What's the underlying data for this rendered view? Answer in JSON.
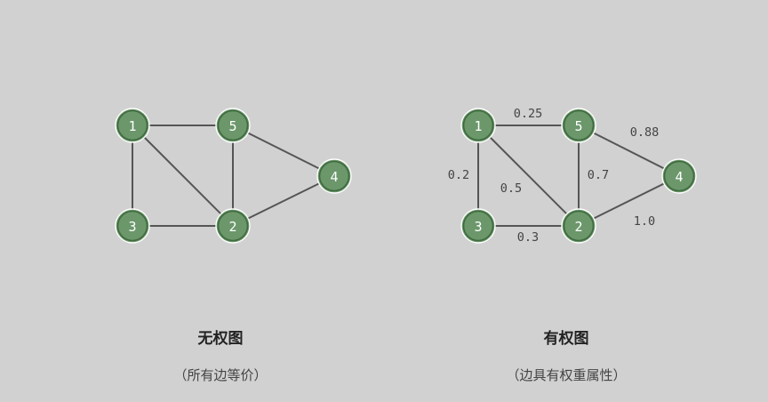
{
  "colors": {
    "background": "#d1d1d1",
    "node_fill": "#6b976b",
    "node_ring": "#3f6a3f",
    "edge": "#555555"
  },
  "unweighted": {
    "title": "无权图",
    "subtitle": "（所有边等价）",
    "nodes": [
      "1",
      "5",
      "4",
      "3",
      "2"
    ],
    "edges": [
      [
        "1",
        "5"
      ],
      [
        "1",
        "3"
      ],
      [
        "1",
        "2"
      ],
      [
        "5",
        "2"
      ],
      [
        "5",
        "4"
      ],
      [
        "3",
        "2"
      ],
      [
        "2",
        "4"
      ]
    ]
  },
  "weighted": {
    "title": "有权图",
    "subtitle": "（边具有权重属性）",
    "nodes": [
      "1",
      "5",
      "4",
      "3",
      "2"
    ],
    "edges": [
      {
        "from": "1",
        "to": "5",
        "weight": "0.25"
      },
      {
        "from": "5",
        "to": "4",
        "weight": "0.88"
      },
      {
        "from": "1",
        "to": "3",
        "weight": "0.2"
      },
      {
        "from": "1",
        "to": "2",
        "weight": "0.5"
      },
      {
        "from": "5",
        "to": "2",
        "weight": "0.7"
      },
      {
        "from": "3",
        "to": "2",
        "weight": "0.3"
      },
      {
        "from": "2",
        "to": "4",
        "weight": "1.0"
      }
    ]
  }
}
